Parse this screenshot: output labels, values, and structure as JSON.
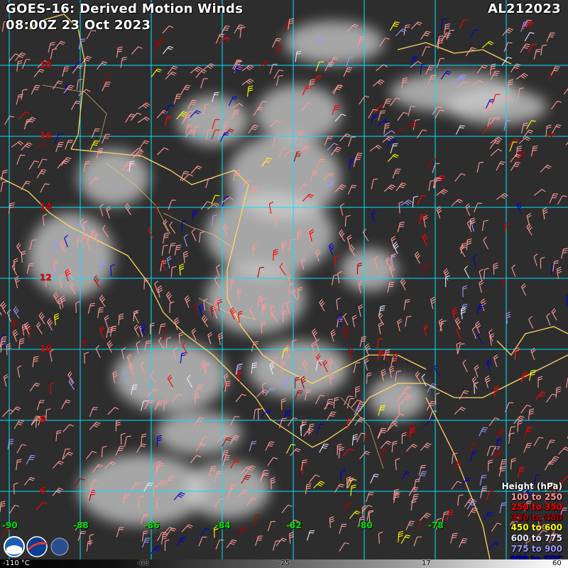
{
  "title": {
    "line1": "GOES-16: Derived Motion Winds",
    "line2": "08:00Z 23 Oct 2023",
    "storm_id": "AL212023"
  },
  "latitude_labels": [
    "18",
    "16",
    "14",
    "12",
    "10",
    "8",
    "6"
  ],
  "longitude_labels": [
    "-90",
    "-88",
    "-86",
    "-84",
    "-82",
    "-80",
    "-78"
  ],
  "legend": {
    "title": "Height (hPa)",
    "entries": [
      {
        "label": "100 to 250",
        "color": "#ff9999"
      },
      {
        "label": "250 to 350",
        "color": "#ff0000"
      },
      {
        "label": "350 to 450",
        "color": "#b00000"
      },
      {
        "label": "450 to 600",
        "color": "#ffff00"
      },
      {
        "label": "600 to 775",
        "color": "#e8e8ff"
      },
      {
        "label": "775 to 900",
        "color": "#9999ff"
      },
      {
        "label": "900 to SFC",
        "color": "#0000cc"
      }
    ]
  },
  "colorbar": {
    "unit_label": "-110 °C",
    "ticks": [
      "-68",
      "-25",
      "17",
      "60"
    ]
  },
  "colors": {
    "grid": "#00e5ff",
    "coastline": "#ffd566",
    "lat_label": "#e00000",
    "lon_label": "#00e000"
  }
}
